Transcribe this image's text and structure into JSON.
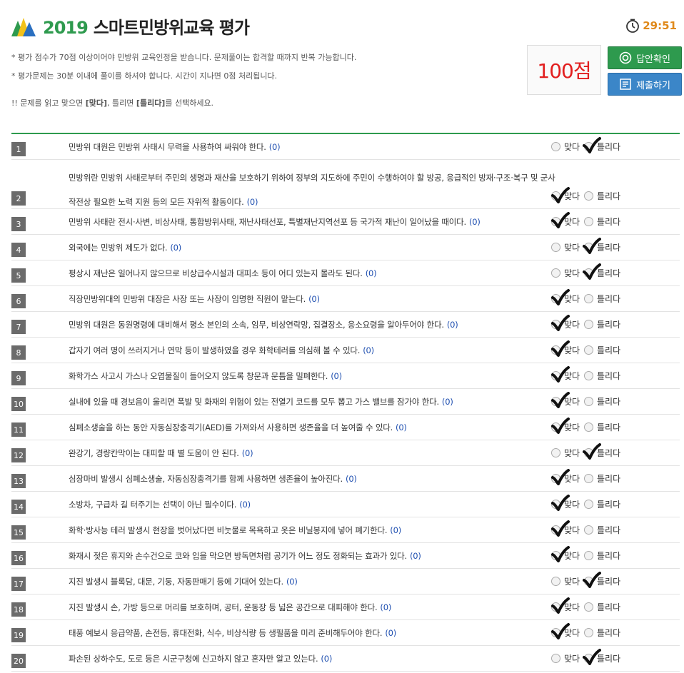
{
  "header": {
    "year": "2019",
    "title": "스마트민방위교육 평가",
    "timer": "29:51"
  },
  "notes": {
    "line1": "* 평가 점수가 70점 이상이어야 민방위 교육인정을 받습니다. 문제풀이는 합격할 때까지 반복 가능합니다.",
    "line2": "* 평가문제는 30분 이내에 풀이를 하셔야 합니다. 시간이 지나면 0점 처리됩니다.",
    "line3_prefix": "!! 문제를 읽고 맞으면 ",
    "line3_o": "[맞다]",
    "line3_mid": ", 틀리면 ",
    "line3_x": "[틀리다]",
    "line3_suffix": "를 선택하세요."
  },
  "score": "100점",
  "buttons": {
    "check": "답안확인",
    "submit": "제출하기"
  },
  "options": {
    "o": "맞다",
    "x": "틀리다"
  },
  "colors": {
    "accent": "#2e9a4e",
    "score": "#e21f1f",
    "timer": "#e08a1c",
    "submit": "#3b86c8",
    "points": "#1f4fb0"
  },
  "questions": [
    {
      "num": "1",
      "text": "민방위 대원은 민방위 사태시 무력을 사용하여 싸워야 한다.",
      "pts": "(0)",
      "answer": "x"
    },
    {
      "num": "2",
      "text": "민방위란 민방위 사태로부터 주민의 생명과 재산을 보호하기 위하여 정부의 지도하에 주민이 수행하여야 할 방공, 응급적인 방재·구조·복구 및 군사 작전상 필요한 노력 지원 등의 모든 자위적 활동이다.",
      "pts": "(0)",
      "answer": "o"
    },
    {
      "num": "3",
      "text": "민방위 사태란 전시·사변, 비상사태, 통합방위사태, 재난사태선포, 특별재난지역선포 등 국가적 재난이 일어났을 때이다.",
      "pts": "(0)",
      "answer": "o"
    },
    {
      "num": "4",
      "text": "외국에는 민방위 제도가 없다.",
      "pts": "(0)",
      "answer": "x"
    },
    {
      "num": "5",
      "text": "평상시 재난은 일어나지 않으므로 비상급수시설과 대피소 등이 어디 있는지 몰라도 된다.",
      "pts": "(0)",
      "answer": "x"
    },
    {
      "num": "6",
      "text": "직장민방위대의 민방위 대장은 사장 또는 사장이 임명한 직원이 맡는다.",
      "pts": "(0)",
      "answer": "o"
    },
    {
      "num": "7",
      "text": "민방위 대원은 동원명령에 대비해서 평소 본인의 소속, 임무, 비상연락망, 집결장소, 응소요령을 알아두어야 한다.",
      "pts": "(0)",
      "answer": "o"
    },
    {
      "num": "8",
      "text": "갑자기 여러 명이 쓰러지거나 연막 등이 발생하였을 경우 화학테러를 의심해 볼 수 있다.",
      "pts": "(0)",
      "answer": "o"
    },
    {
      "num": "9",
      "text": "화학가스 사고시 가스나 오염물질이 들어오지 않도록 창문과 문틈을 밀폐한다.",
      "pts": "(0)",
      "answer": "o"
    },
    {
      "num": "10",
      "text": "실내에 있을 때 경보음이 울리면 폭발 및 화재의 위험이 있는 전열기 코드를 모두 뽑고 가스 밸브를 잠가야 한다.",
      "pts": "(0)",
      "answer": "o"
    },
    {
      "num": "11",
      "text": "심폐소생술을 하는 동안 자동심장충격기(AED)를 가져와서 사용하면 생존율을 더 높여줄 수 있다.",
      "pts": "(0)",
      "answer": "o"
    },
    {
      "num": "12",
      "text": "완강기, 경량칸막이는 대피할 때 별 도움이 안 된다.",
      "pts": "(0)",
      "answer": "x"
    },
    {
      "num": "13",
      "text": "심장마비 발생시 심폐소생술, 자동심장충격기를 함께 사용하면 생존율이 높아진다.",
      "pts": "(0)",
      "answer": "o"
    },
    {
      "num": "14",
      "text": "소방차, 구급차 길 터주기는 선택이 아닌 필수이다.",
      "pts": "(0)",
      "answer": "o"
    },
    {
      "num": "15",
      "text": "화학·방사능 테러 발생시 현장을 벗어났다면 비눗물로 목욕하고 옷은 비닐봉지에 넣어 폐기한다.",
      "pts": "(0)",
      "answer": "o"
    },
    {
      "num": "16",
      "text": "화재시 젖은 휴지와 손수건으로 코와 입을 막으면 방독면처럼 공기가 어느 정도 정화되는 효과가 있다.",
      "pts": "(0)",
      "answer": "o"
    },
    {
      "num": "17",
      "text": "지진 발생시 블록담, 대문, 기둥, 자동판매기 등에 기대어 있는다.",
      "pts": "(0)",
      "answer": "x"
    },
    {
      "num": "18",
      "text": "지진 발생시 손, 가방 등으로 머리를 보호하며, 공터, 운동장 등 넓은 공간으로 대피해야 한다.",
      "pts": "(0)",
      "answer": "o"
    },
    {
      "num": "19",
      "text": "태풍 예보시 응급약품, 손전등, 휴대전화, 식수, 비상식량 등 생필품을 미리 준비해두어야 한다.",
      "pts": "(0)",
      "answer": "o"
    },
    {
      "num": "20",
      "text": "파손된 상하수도, 도로 등은 시군구청에 신고하지 않고 혼자만 알고 있는다.",
      "pts": "(0)",
      "answer": "x"
    }
  ]
}
